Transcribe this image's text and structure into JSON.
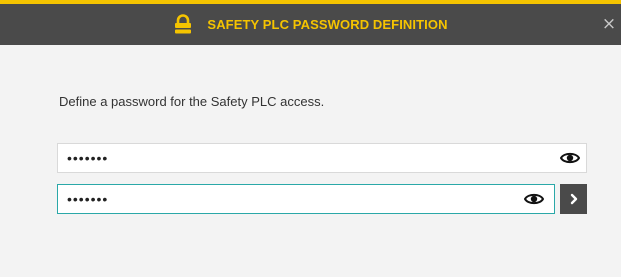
{
  "dialog": {
    "title": "SAFETY PLC PASSWORD DEFINITION",
    "close_label": "×",
    "prompt": "Define a password for the Safety PLC access.",
    "password": {
      "value": "•••••••",
      "type": "password"
    },
    "confirm_password": {
      "value": "•••••••",
      "type": "password"
    }
  },
  "colors": {
    "accent": "#f5c400",
    "titlebar": "#4a4a4a",
    "focus_border": "#2aa8a8",
    "background": "#f3f3f3"
  },
  "icons": {
    "title": "lock-icon",
    "close": "close-icon",
    "reveal": "eye-icon",
    "submit": "chevron-right-icon"
  }
}
